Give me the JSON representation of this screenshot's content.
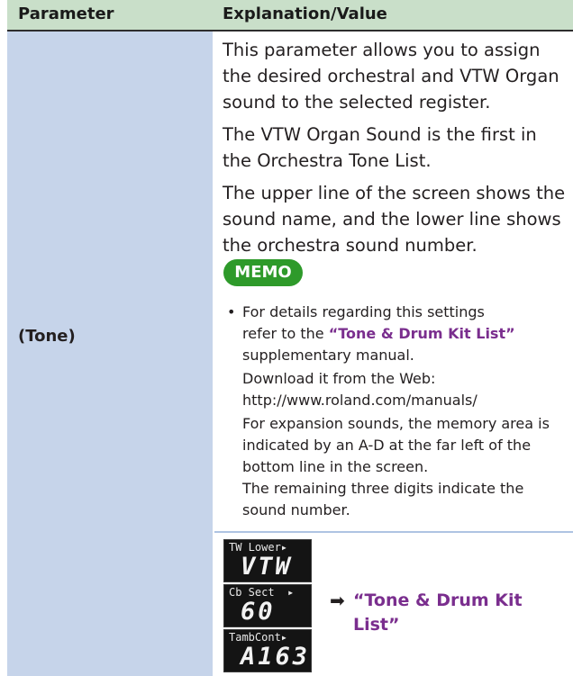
{
  "header": {
    "col_param": "Parameter",
    "col_value": "Explanation/Value"
  },
  "param": {
    "name": "(Tone)"
  },
  "desc": {
    "p1": "This parameter allows you to assign the desired orchestral and VTW Organ sound to the selected register.",
    "p2": "The VTW Organ Sound is the first in the Orchestra Tone List.",
    "p3": "The upper line of the screen shows the sound name, and the lower line shows the orchestra sound number."
  },
  "memo": {
    "label": "MEMO",
    "bullet": "•",
    "line1": "For details regarding this settings",
    "line2_pre": "refer to the ",
    "line2_link": "“Tone & Drum Kit List”",
    "line3": "supplementary manual.",
    "download": "Download it from the Web:",
    "url": "http://www.roland.com/manuals/",
    "expansion": "For expansion sounds, the memory area is indicated by an A-D at the far left of the bottom line in the screen.",
    "remaining": "The remaining three digits indicate the sound number."
  },
  "screens": [
    {
      "top": "TW Lower▸",
      "bottom": "VTW"
    },
    {
      "top": "Cb Sect  ▸",
      "bottom": "60"
    },
    {
      "top": "TambCont▸",
      "bottom": "A163"
    }
  ],
  "reference": {
    "arrow": "➡",
    "text": "“Tone & Drum Kit List”"
  }
}
